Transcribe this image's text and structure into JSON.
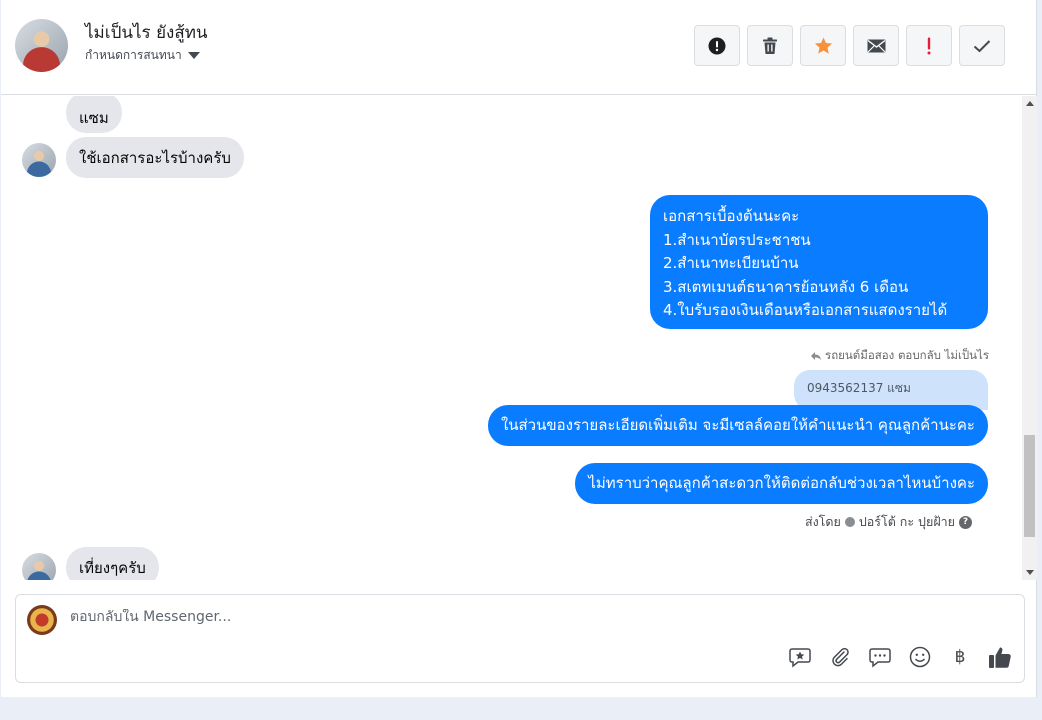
{
  "header": {
    "contact_name": "ไม่เป็นไร ยังสู้ทน",
    "assign_label": "กำหนดการสนทนา",
    "actions": [
      {
        "name": "spam-button",
        "icon": "exclamation-circle-icon",
        "color": "#1c1e21"
      },
      {
        "name": "delete-button",
        "icon": "trash-icon",
        "color": "#444950"
      },
      {
        "name": "star-button",
        "icon": "star-icon",
        "color": "#f7923a"
      },
      {
        "name": "mark-unread-button",
        "icon": "envelope-icon",
        "color": "#444950"
      },
      {
        "name": "follow-up-button",
        "icon": "exclamation-icon",
        "color": "#e41e3f"
      },
      {
        "name": "mark-done-button",
        "icon": "check-icon",
        "color": "#444950"
      }
    ]
  },
  "messages": {
    "in_partial": "แซม",
    "in_1": "ใช้เอกสารอะไรบ้างครับ",
    "out_docs": [
      "เอกสารเบื้องต้นนะคะ",
      "1.สำเนาบัตรประชาชน",
      "2.สำเนาทะเบียนบ้าน",
      "3.สเตทเมนต์ธนาคารย้อนหลัง 6 เดือน",
      "4.ใบรับรองเงินเดือนหรือเอกสารแสดงรายได้"
    ],
    "reply_meta": "รถยนต์มือสอง ตอบกลับ ไม่เป็นไร",
    "quoted": "0943562137 แซม",
    "out_2": "ในส่วนของรายละเอียดเพิ่มเติม จะมีเซลล์คอยให้คำแนะนำ คุณลูกค้านะคะ",
    "out_3": "ไม่ทราบว่าคุณลูกค้าสะดวกให้ติดต่อกลับช่วงเวลาไหนบ้างคะ",
    "sent_by_label": "ส่งโดย",
    "sent_by_name": "ปอร์โต้ กะ ปุยฝ้าย",
    "in_2": "เที่ยงๆครับ"
  },
  "composer": {
    "placeholder": "ตอบกลับใน Messenger...",
    "currency_symbol": "฿"
  },
  "colors": {
    "outgoing_bubble": "#0a7cff",
    "incoming_bubble": "#e4e6eb",
    "quoted_bubble": "#cfe2fb"
  }
}
